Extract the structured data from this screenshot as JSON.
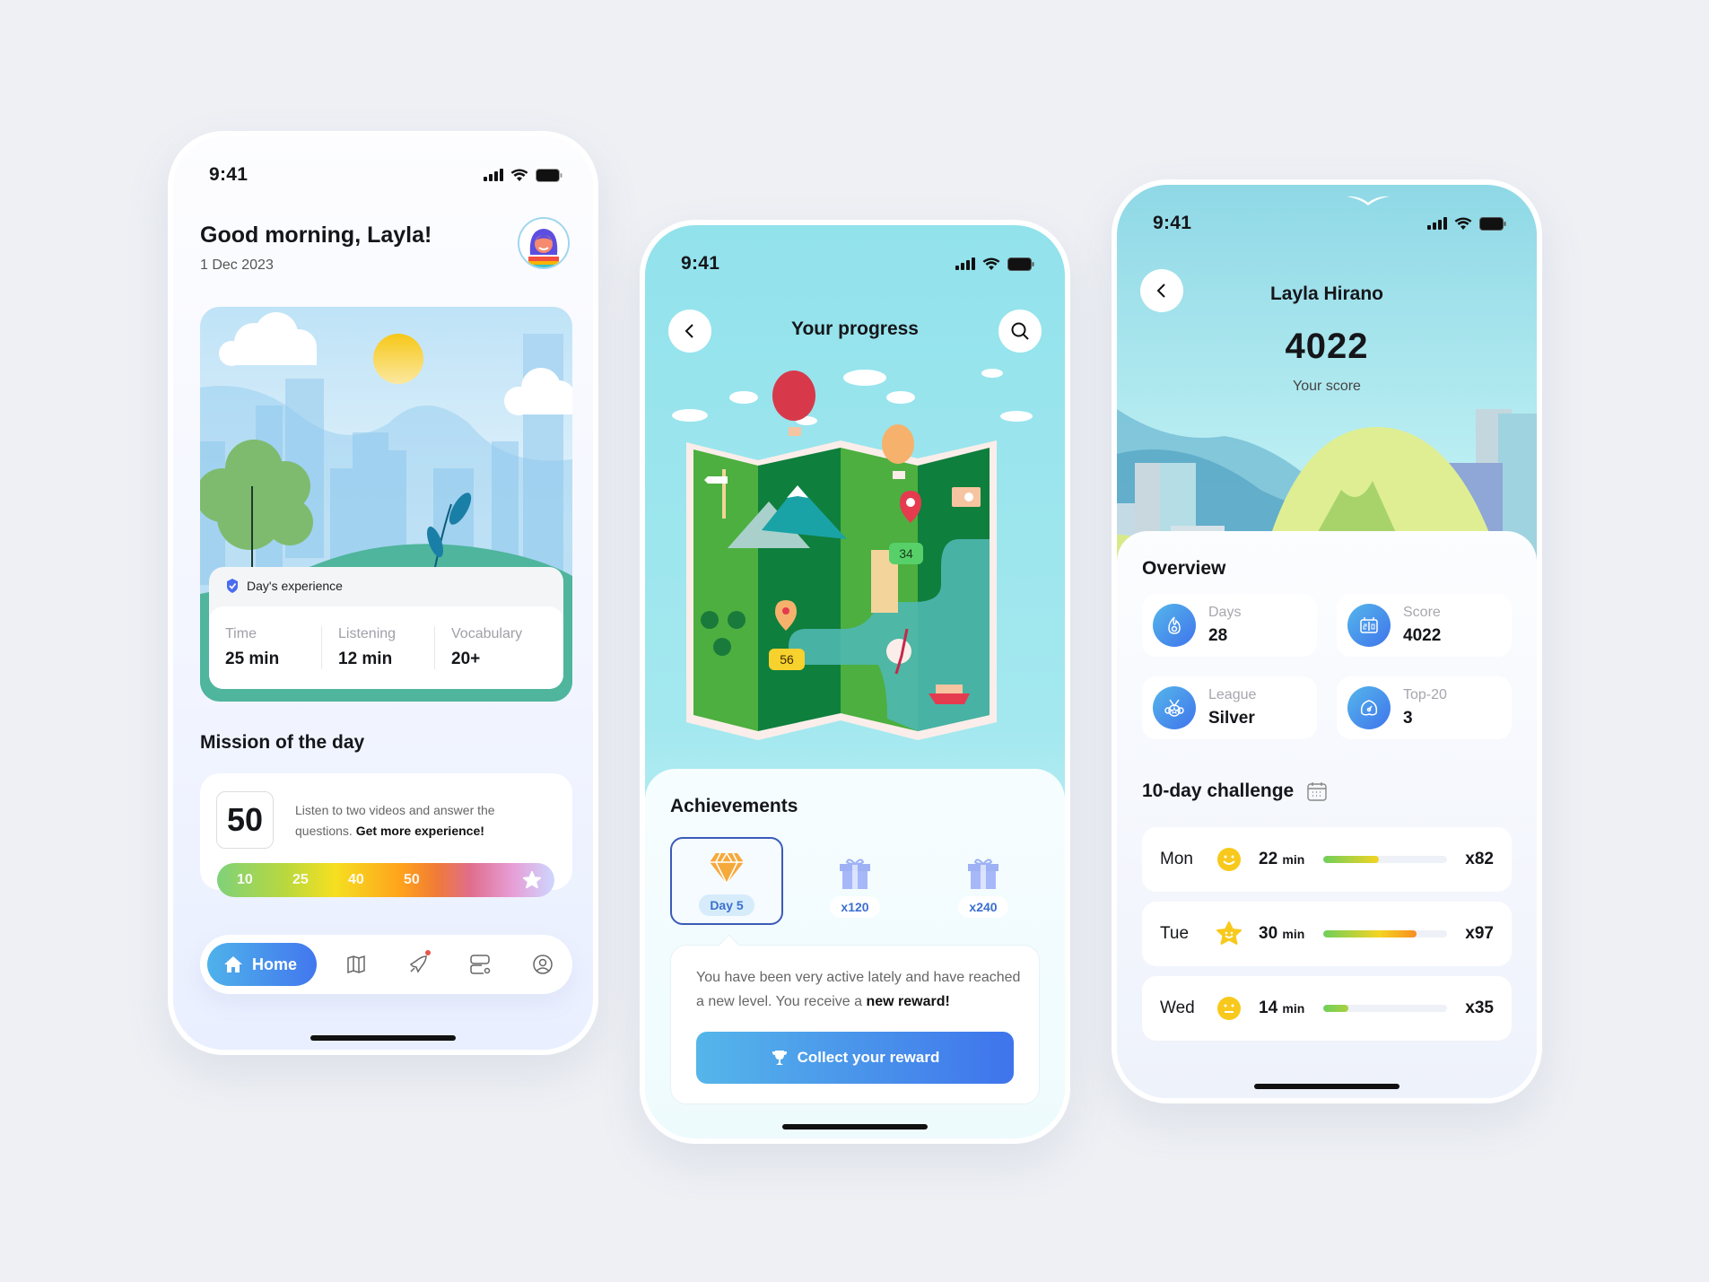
{
  "status_bar": {
    "time": "9:41"
  },
  "home": {
    "greeting": "Good morning, Layla!",
    "date": "1 Dec 2023",
    "days_experience": {
      "title": "Day's experience",
      "stats": [
        {
          "label": "Time",
          "value": "25 min"
        },
        {
          "label": "Listening",
          "value": "12 min"
        },
        {
          "label": "Vocabulary",
          "value": "20+"
        }
      ]
    },
    "mission": {
      "title": "Mission of the day",
      "points": "50",
      "text": "Listen to two videos and answer the questions.",
      "text_bold": "Get more experience!",
      "milestones": [
        "10",
        "25",
        "40",
        "50"
      ],
      "milestone_icon": "star-icon"
    },
    "tabbar": {
      "items": [
        {
          "label": "Home",
          "icon": "home-icon",
          "active": true
        },
        {
          "label": "",
          "icon": "map-icon",
          "active": false
        },
        {
          "label": "",
          "icon": "rocket-icon",
          "active": false,
          "badge": true
        },
        {
          "label": "",
          "icon": "settings-icon",
          "active": false
        },
        {
          "label": "",
          "icon": "profile-icon",
          "active": false
        }
      ]
    }
  },
  "progress": {
    "title": "Your progress",
    "map_markers": [
      "34",
      "56"
    ],
    "achievements_title": "Achievements",
    "achievements": [
      {
        "label": "Day 5",
        "icon": "diamond-icon",
        "active": true
      },
      {
        "label": "x120",
        "icon": "gift-icon",
        "active": false
      },
      {
        "label": "x240",
        "icon": "gift-icon",
        "active": false
      }
    ],
    "reward_text": "You have been very active lately and have reached a new level. You receive a",
    "reward_text_bold": "new reward!",
    "reward_button": "Collect your reward"
  },
  "profile": {
    "name": "Layla Hirano",
    "score": "4022",
    "score_label": "Your score",
    "overview_title": "Overview",
    "overview": [
      {
        "label": "Days",
        "value": "28",
        "icon": "flame-icon"
      },
      {
        "label": "Score",
        "value": "4022",
        "icon": "scoreboard-icon"
      },
      {
        "label": "League",
        "value": "Silver",
        "icon": "medal-icon"
      },
      {
        "label": "Top-20",
        "value": "3",
        "icon": "gauge-icon"
      }
    ],
    "challenge_title": "10-day challenge",
    "challenge": [
      {
        "day": "Mon",
        "mood": "smile",
        "minutes": "22",
        "unit": "min",
        "progress": 0.45,
        "multiplier": "x82"
      },
      {
        "day": "Tue",
        "mood": "star",
        "minutes": "30",
        "unit": "min",
        "progress": 0.75,
        "multiplier": "x97"
      },
      {
        "day": "Wed",
        "mood": "neutral",
        "minutes": "14",
        "unit": "min",
        "progress": 0.2,
        "multiplier": "x35"
      }
    ]
  },
  "colors": {
    "accent_start": "#55b6ea",
    "accent_end": "#3f74ec",
    "active_border": "#3a5bb8"
  }
}
